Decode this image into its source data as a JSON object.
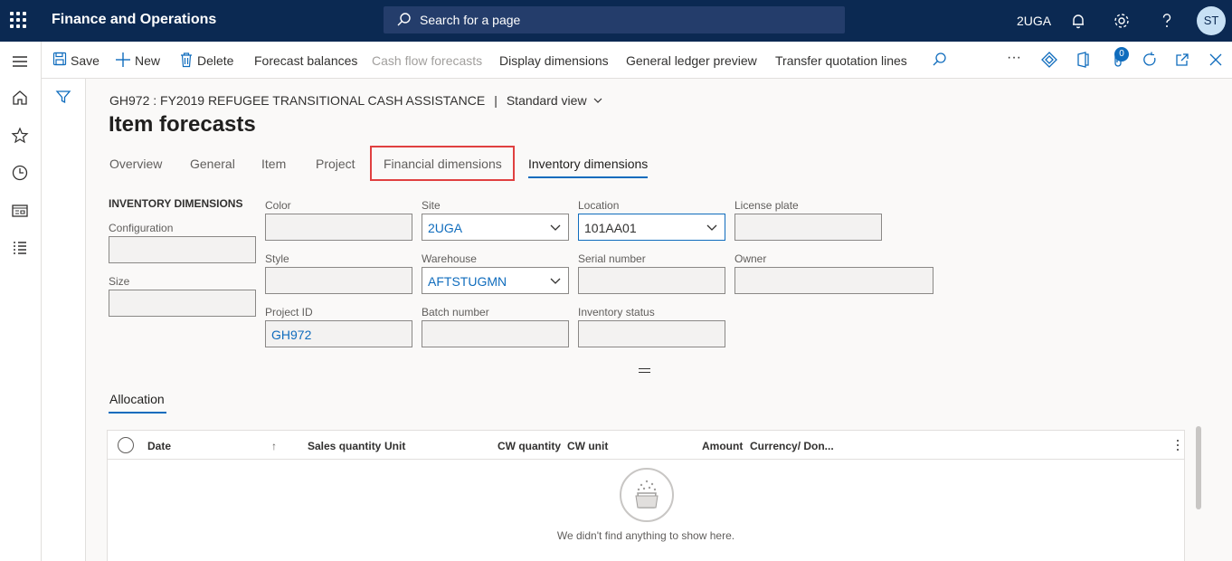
{
  "topbar": {
    "app_title": "Finance and Operations",
    "search_placeholder": "Search for a page",
    "company": "2UGA",
    "avatar_initials": "ST"
  },
  "actions": {
    "save": "Save",
    "new": "New",
    "delete": "Delete",
    "forecast_balances": "Forecast balances",
    "cash_flow_forecasts": "Cash flow forecasts",
    "display_dimensions": "Display dimensions",
    "general_ledger_preview": "General ledger preview",
    "transfer_quotation_lines": "Transfer quotation lines",
    "more": "···",
    "attachments_count": "0"
  },
  "page": {
    "caption_record": "GH972 : FY2019 REFUGEE TRANSITIONAL CASH ASSISTANCE",
    "caption_sep": "|",
    "view_name": "Standard view",
    "title": "Item forecasts"
  },
  "tabs": [
    "Overview",
    "General",
    "Item",
    "Project",
    "Financial dimensions",
    "Inventory dimensions"
  ],
  "inventory": {
    "group_title": "INVENTORY DIMENSIONS",
    "configuration": {
      "label": "Configuration",
      "value": ""
    },
    "size": {
      "label": "Size",
      "value": ""
    },
    "color": {
      "label": "Color",
      "value": ""
    },
    "style": {
      "label": "Style",
      "value": ""
    },
    "project_id": {
      "label": "Project ID",
      "value": "GH972"
    },
    "site": {
      "label": "Site",
      "value": "2UGA"
    },
    "warehouse": {
      "label": "Warehouse",
      "value": "AFTSTUGMN"
    },
    "batch_number": {
      "label": "Batch number",
      "value": ""
    },
    "location": {
      "label": "Location",
      "value": "101AA01"
    },
    "serial_number": {
      "label": "Serial number",
      "value": ""
    },
    "inventory_status": {
      "label": "Inventory status",
      "value": ""
    },
    "license_plate": {
      "label": "License plate",
      "value": ""
    },
    "owner": {
      "label": "Owner",
      "value": ""
    }
  },
  "allocation": {
    "tab_label": "Allocation",
    "columns": [
      "Date",
      "Sales quantity",
      "Unit",
      "CW quantity",
      "CW unit",
      "Amount",
      "Currency/ Don..."
    ],
    "sort_indicator": "↑",
    "empty_message": "We didn't find anything to show here."
  },
  "colors": {
    "nav_bg": "#0b2952",
    "accent": "#0f6cbd",
    "highlight": "#e04040"
  }
}
